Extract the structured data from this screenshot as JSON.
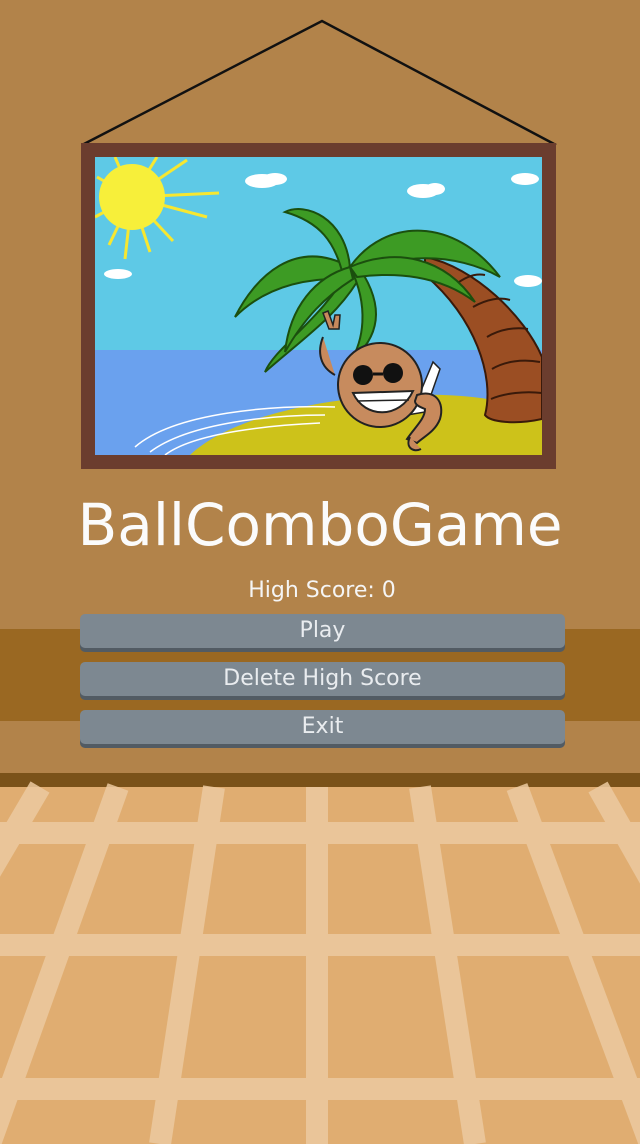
{
  "game": {
    "title": "BallComboGame",
    "high_score_label": "High Score:",
    "high_score_value": 0,
    "high_score_text": "High Score: 0"
  },
  "menu": {
    "play_label": "Play",
    "delete_label": "Delete High Score",
    "exit_label": "Exit"
  },
  "colors": {
    "wall": "#b2834a",
    "wall_band": "#9a6822",
    "floor": "#e0ad71",
    "button": "#7d8891",
    "frame": "#6b3d2e",
    "sky": "#5ec9e6",
    "sea": "#6aa1ee",
    "sand": "#cdc21a"
  },
  "picture": {
    "subject": "coconut-character-on-beach-chair-under-palm-tree"
  }
}
